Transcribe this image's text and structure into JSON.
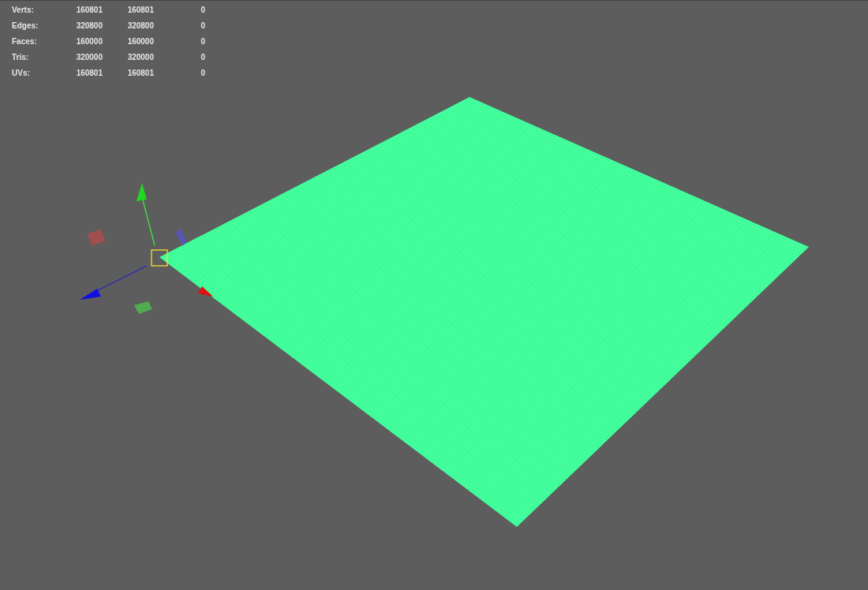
{
  "stats": [
    {
      "label": "Verts:",
      "values": [
        "160801",
        "160801",
        "0"
      ]
    },
    {
      "label": "Edges:",
      "values": [
        "320800",
        "320800",
        "0"
      ]
    },
    {
      "label": "Faces:",
      "values": [
        "160000",
        "160000",
        "0"
      ]
    },
    {
      "label": "Tris:",
      "values": [
        "320000",
        "320000",
        "0"
      ]
    },
    {
      "label": "UVs:",
      "values": [
        "160801",
        "160801",
        "0"
      ]
    }
  ]
}
